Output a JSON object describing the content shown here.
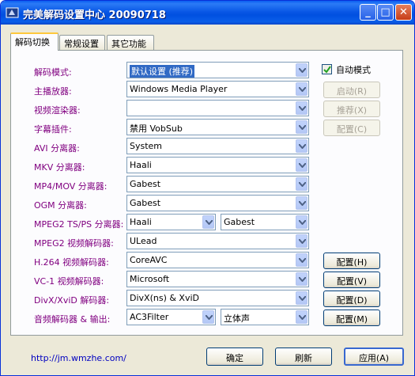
{
  "window": {
    "title": "完美解码设置中心  20090718",
    "minimize": "_",
    "maximize": "□",
    "close": "✕"
  },
  "tabs": [
    {
      "label": "解码切换"
    },
    {
      "label": "常规设置"
    },
    {
      "label": "其它功能"
    }
  ],
  "rows": [
    {
      "label": "解码模式:",
      "value": "默认设置 (推荐)"
    },
    {
      "label": "主播放器:",
      "value": "Windows Media Player"
    },
    {
      "label": "视频渲染器:",
      "value": ""
    },
    {
      "label": "字幕插件:",
      "value": "禁用 VobSub"
    },
    {
      "label": "AVI 分离器:",
      "value": "System"
    },
    {
      "label": "MKV 分离器:",
      "value": "Haali"
    },
    {
      "label": "MP4/MOV 分离器:",
      "value": "Gabest"
    },
    {
      "label": "OGM 分离器:",
      "value": "Gabest"
    },
    {
      "label": "MPEG2 TS/PS 分离器:",
      "value": "Haali",
      "value2": "Gabest"
    },
    {
      "label": "MPEG2 视频解码器:",
      "value": "ULead"
    },
    {
      "label": "H.264 视频解码器:",
      "value": "CoreAVC"
    },
    {
      "label": "VC-1 视频解码器:",
      "value": "Microsoft"
    },
    {
      "label": "DivX/XviD 解码器:",
      "value": "DivX(ns) & XviD"
    },
    {
      "label": "音频解码器 & 输出:",
      "value": "AC3Filter",
      "value2": "立体声"
    }
  ],
  "auto_mode": {
    "label": "自动模式",
    "checked": true
  },
  "side_buttons": {
    "start": "启动(R)",
    "recommend": "推荐(X)",
    "config_c": "配置(C)",
    "config_h": "配置(H)",
    "config_v": "配置(V)",
    "config_d": "配置(D)",
    "config_m": "配置(M)"
  },
  "footer": {
    "link": "http://jm.wmzhe.com/",
    "ok": "确定",
    "refresh": "刷新",
    "apply": "应用(A)"
  },
  "colors": {
    "label_purple": "#800080",
    "titlebar_blue": "#0a58e6",
    "selection_blue": "#316ac5"
  }
}
